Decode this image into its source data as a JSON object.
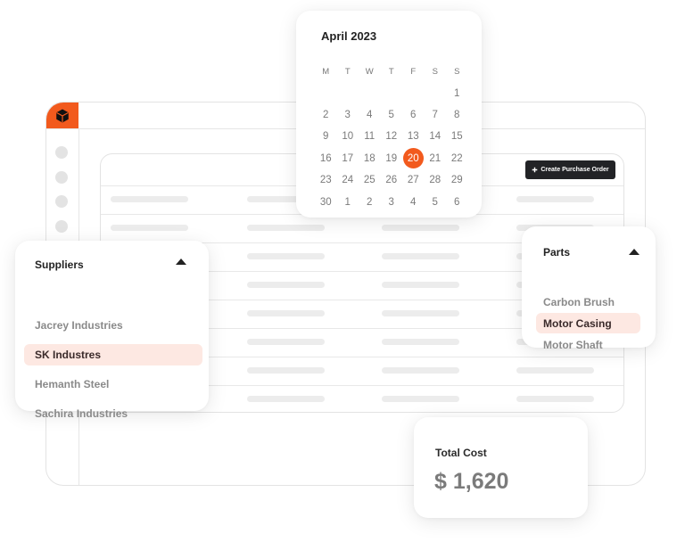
{
  "app": {
    "logo_icon": "cube-icon",
    "accent_color": "#f25a1d",
    "sidebar_items": 4,
    "table": {
      "action_button": {
        "icon": "plus-icon",
        "label": "Create Purchase Order"
      },
      "rows": 8,
      "columns": 4
    }
  },
  "calendar": {
    "title": "April 2023",
    "weekdays": [
      "M",
      "T",
      "W",
      "T",
      "F",
      "S",
      "S"
    ],
    "weeks": [
      [
        "",
        "",
        "",
        "",
        "",
        "",
        "1"
      ],
      [
        "2",
        "3",
        "4",
        "5",
        "6",
        "7",
        "8"
      ],
      [
        "9",
        "10",
        "11",
        "12",
        "13",
        "14",
        "15"
      ],
      [
        "16",
        "17",
        "18",
        "19",
        "20",
        "21",
        "22"
      ],
      [
        "23",
        "24",
        "25",
        "26",
        "27",
        "28",
        "29"
      ],
      [
        "30",
        "1",
        "2",
        "3",
        "4",
        "5",
        "6"
      ]
    ],
    "selected_day": "20"
  },
  "suppliers": {
    "title": "Suppliers",
    "caret_icon": "caret-up-icon",
    "items": [
      {
        "label": "Jacrey Industries",
        "selected": false
      },
      {
        "label": "SK Industres",
        "selected": true
      },
      {
        "label": "Hemanth Steel",
        "selected": false
      },
      {
        "label": "Sachira Industries",
        "selected": false
      }
    ]
  },
  "parts": {
    "title": "Parts",
    "caret_icon": "caret-up-icon",
    "items": [
      {
        "label": "Carbon Brush",
        "selected": false
      },
      {
        "label": "Motor Casing",
        "selected": true
      },
      {
        "label": "Motor Shaft",
        "selected": false
      }
    ]
  },
  "total_cost": {
    "label": "Total Cost",
    "value": "$ 1,620"
  }
}
